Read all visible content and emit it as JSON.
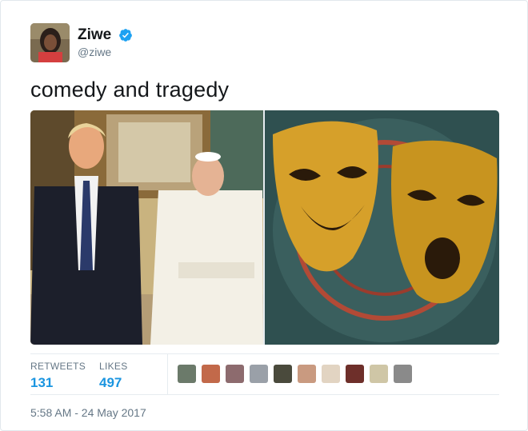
{
  "user": {
    "name": "Ziwe",
    "handle": "@ziwe",
    "verified": true,
    "avatar_icon": "profile-photo"
  },
  "tweet": {
    "text": "comedy and tragedy",
    "timestamp": "5:58 AM - 24 May 2017"
  },
  "media": {
    "left_image": "photo-two-men-posing",
    "right_image": "photo-gold-theatre-masks"
  },
  "stats": {
    "retweets_label": "RETWEETS",
    "retweets_count": "131",
    "likes_label": "LIKES",
    "likes_count": "497"
  },
  "likers": [
    {
      "color": "#6b7a6a"
    },
    {
      "color": "#c2694a"
    },
    {
      "color": "#8d6b6e"
    },
    {
      "color": "#9aa0a8"
    },
    {
      "color": "#4a4a3c"
    },
    {
      "color": "#c99a80"
    },
    {
      "color": "#e2d4c2"
    },
    {
      "color": "#6e2f2a"
    },
    {
      "color": "#cfc6a6"
    },
    {
      "color": "#8a8a8a"
    }
  ],
  "colors": {
    "accent": "#1b95e0",
    "muted": "#657786",
    "verified": "#1da1f2"
  }
}
